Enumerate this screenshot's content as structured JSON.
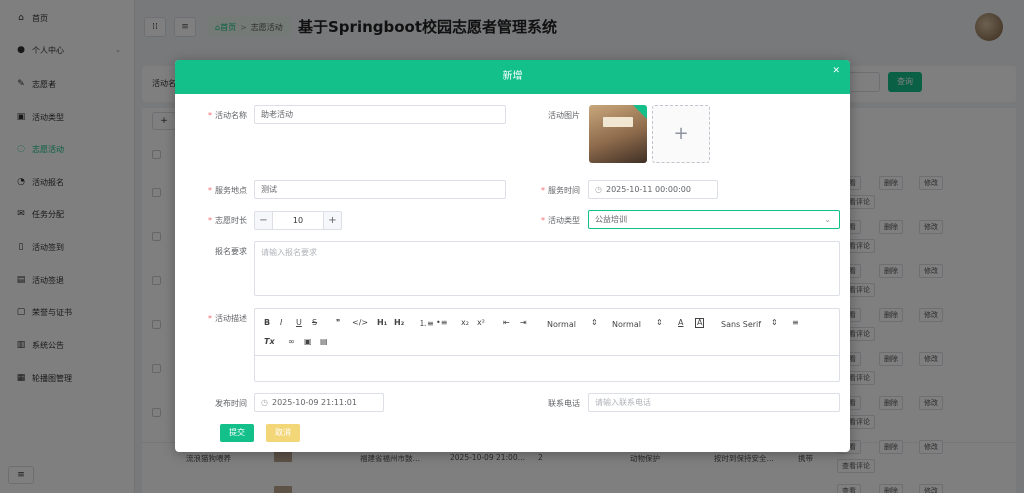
{
  "sidebar": {
    "items": [
      {
        "label": "首页",
        "icon": "home-icon",
        "glyph": "⌂"
      },
      {
        "label": "个人中心",
        "icon": "user-icon",
        "glyph": "●",
        "expand": "⌄"
      },
      {
        "label": "志愿者",
        "icon": "edit-icon",
        "glyph": "✎"
      },
      {
        "label": "活动类型",
        "icon": "tag-icon",
        "glyph": "▣"
      },
      {
        "label": "志愿活动",
        "icon": "chat-icon",
        "glyph": "◌"
      },
      {
        "label": "活动报名",
        "icon": "pie-icon",
        "glyph": "◔"
      },
      {
        "label": "任务分配",
        "icon": "mail-icon",
        "glyph": "✉"
      },
      {
        "label": "活动签到",
        "icon": "book-icon",
        "glyph": "▯"
      },
      {
        "label": "活动签退",
        "icon": "calendar-icon",
        "glyph": "▤"
      },
      {
        "label": "荣誉与证书",
        "icon": "message-icon",
        "glyph": "▢"
      },
      {
        "label": "系统公告",
        "icon": "chart-icon",
        "glyph": "▥"
      },
      {
        "label": "轮播图管理",
        "icon": "image-icon",
        "glyph": "▦"
      }
    ],
    "footer_glyph": "≡"
  },
  "topbar": {
    "grid_glyph": "⁞⁞",
    "menu_glyph": "≡",
    "breadcrumb_home": "首页",
    "breadcrumb_sep": ">",
    "breadcrumb_current": "志愿活动",
    "system_title": "基于Springboot校园志愿者管理系统"
  },
  "search": {
    "label": "活动名",
    "query_button": "查询"
  },
  "table": {
    "add_glyph": "+",
    "actions": {
      "view": "查看",
      "delete": "删除",
      "edit": "修改",
      "view_comments": "查看评论"
    },
    "visible_row": {
      "name": "流浪猫狗喂养",
      "address": "福建省福州市鼓…",
      "time": "2025-10-09 21:00…",
      "hours": "2",
      "type": "动物保护",
      "requirement": "按时到保持安全…",
      "extra": "携带"
    }
  },
  "dialog": {
    "title": "新增",
    "close_glyph": "✕",
    "fields": {
      "activity_name": {
        "label": "活动名称",
        "value": "助老活动"
      },
      "activity_image": {
        "label": "活动图片",
        "upload_glyph": "+"
      },
      "service_location": {
        "label": "服务地点",
        "value": "测试"
      },
      "service_time": {
        "label": "服务时间",
        "value": "2025-10-11 00:00:00",
        "icon": "clock-icon"
      },
      "volunteer_hours": {
        "label": "志愿时长",
        "value": "10",
        "minus": "−",
        "plus": "+"
      },
      "activity_type": {
        "label": "活动类型",
        "value": "公益培训",
        "chevron": "⌄"
      },
      "signup_requirement": {
        "label": "报名要求",
        "placeholder": "请输入报名要求"
      },
      "activity_description": {
        "label": "活动描述"
      },
      "publish_time": {
        "label": "发布时间",
        "value": "2025-10-09 21:11:01"
      },
      "contact_phone": {
        "label": "联系电话",
        "placeholder": "请输入联系电话"
      }
    },
    "editor_toolbar": {
      "bold": "B",
      "italic": "I",
      "underline": "U",
      "strike": "S",
      "blockquote": "❞",
      "code": "</>",
      "h1": "H₁",
      "h2": "H₂",
      "ordered_list": "⒈≡",
      "bullet_list": "•≡",
      "subscript": "x₂",
      "superscript": "x²",
      "outdent": "⇤",
      "indent": "⇥",
      "size_select": "Normal",
      "header_select": "Normal",
      "font_color": "A",
      "background_color": "A̲",
      "font_select": "Sans Serif",
      "align": "≡",
      "clean": "Tx",
      "link": "🔗",
      "image": "▣",
      "video": "▤",
      "select_arrow": "⇕"
    },
    "buttons": {
      "submit": "提交",
      "cancel": "取消"
    }
  }
}
